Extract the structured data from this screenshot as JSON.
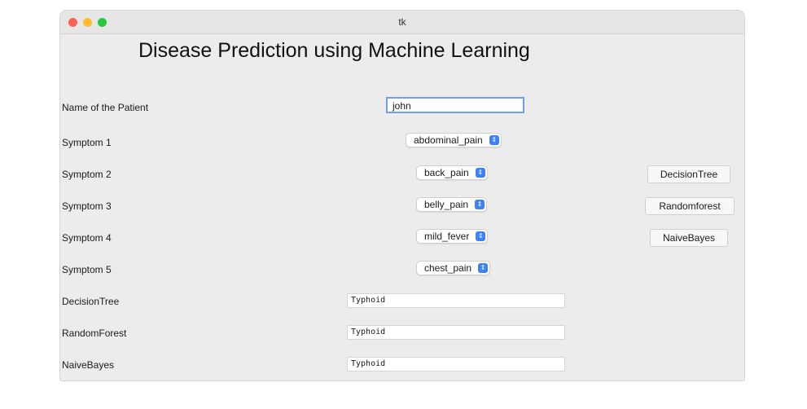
{
  "window": {
    "title": "tk",
    "accent_color": "#3b82f6"
  },
  "heading": "Disease Prediction using Machine Learning",
  "patient": {
    "label": "Name of the Patient",
    "value": "john"
  },
  "symptoms": [
    {
      "label": "Symptom 1",
      "value": "abdominal_pain"
    },
    {
      "label": "Symptom 2",
      "value": "back_pain"
    },
    {
      "label": "Symptom 3",
      "value": "belly_pain"
    },
    {
      "label": "Symptom 4",
      "value": "mild_fever"
    },
    {
      "label": "Symptom 5",
      "value": "chest_pain"
    }
  ],
  "buttons": {
    "decision_tree": "DecisionTree",
    "random_forest": "Randomforest",
    "naive_bayes": "NaiveBayes"
  },
  "results": [
    {
      "label": "DecisionTree",
      "value": "Typhoid"
    },
    {
      "label": "RandomForest",
      "value": "Typhoid"
    },
    {
      "label": "NaiveBayes",
      "value": "Typhoid"
    }
  ],
  "icons": {
    "dropdown": "chevron-updown-icon"
  }
}
